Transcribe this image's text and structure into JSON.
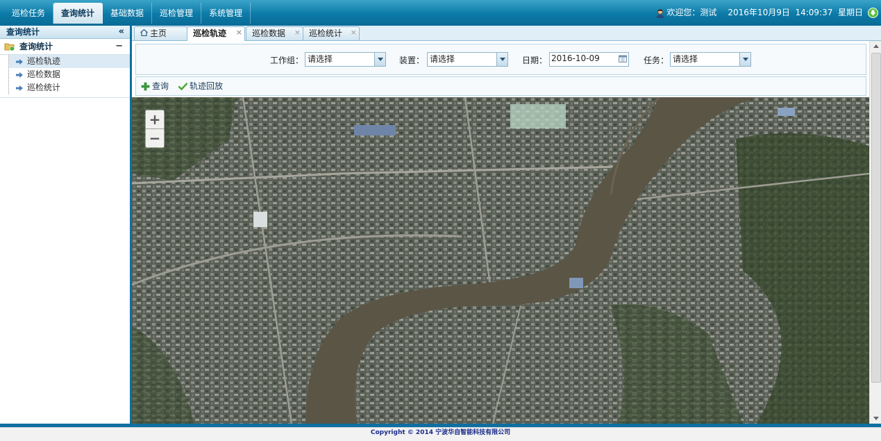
{
  "nav": {
    "items": [
      {
        "label": "巡检任务",
        "active": false
      },
      {
        "label": "查询统计",
        "active": true
      },
      {
        "label": "基础数据",
        "active": false
      },
      {
        "label": "巡检管理",
        "active": false
      },
      {
        "label": "系统管理",
        "active": false
      }
    ]
  },
  "header": {
    "welcome": "欢迎您：测试",
    "datetime": "2016年10月9日  14:09:37  星期日"
  },
  "sidebar": {
    "title": "查询统计",
    "group": "查询统计",
    "items": [
      {
        "label": "巡检轨迹",
        "selected": true
      },
      {
        "label": "巡检数据",
        "selected": false
      },
      {
        "label": "巡检统计",
        "selected": false
      }
    ]
  },
  "tabs": [
    {
      "label": "主页",
      "active": false,
      "closable": false
    },
    {
      "label": "巡检轨迹",
      "active": true,
      "closable": true
    },
    {
      "label": "巡检数据",
      "active": false,
      "closable": true
    },
    {
      "label": "巡检统计",
      "active": false,
      "closable": true
    }
  ],
  "filters": {
    "workgroup_label": "工作组：",
    "workgroup_value": "请选择",
    "device_label": "装置：",
    "device_value": "请选择",
    "date_label": "日期：",
    "date_value": "2016-10-09",
    "task_label": "任务：",
    "task_value": "请选择"
  },
  "toolbar": {
    "query_label": "查询",
    "playback_label": "轨迹回放"
  },
  "map": {
    "zoom_in": "+",
    "zoom_out": "−"
  },
  "footer": {
    "copyright": "Copyright © 2014 宁波华自智能科技有限公司"
  },
  "colors": {
    "primary": "#0e6fa0",
    "nav_gradient_top": "#3aa3c9",
    "river": "#5b5546",
    "footer_text": "#1a2c8a"
  }
}
